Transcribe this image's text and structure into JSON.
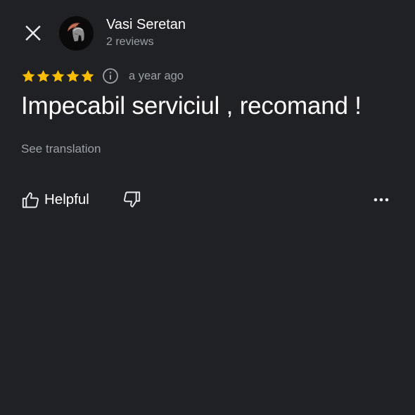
{
  "colors": {
    "background": "#202124",
    "primary_text": "#ffffff",
    "secondary_text": "#9aa0a6",
    "star": "#fbbc04"
  },
  "reviewer": {
    "name": "Vasi Seretan",
    "reviews_count": "2 reviews"
  },
  "review": {
    "rating": 5,
    "rating_max": 5,
    "time": "a year ago",
    "text": "Impecabil serviciul , recomand !",
    "see_translation_label": "See translation"
  },
  "actions": {
    "helpful_label": "Helpful",
    "icons": [
      "close-icon",
      "info-icon",
      "thumbs-up-icon",
      "thumbs-down-icon",
      "more-horizontal-icon"
    ]
  }
}
